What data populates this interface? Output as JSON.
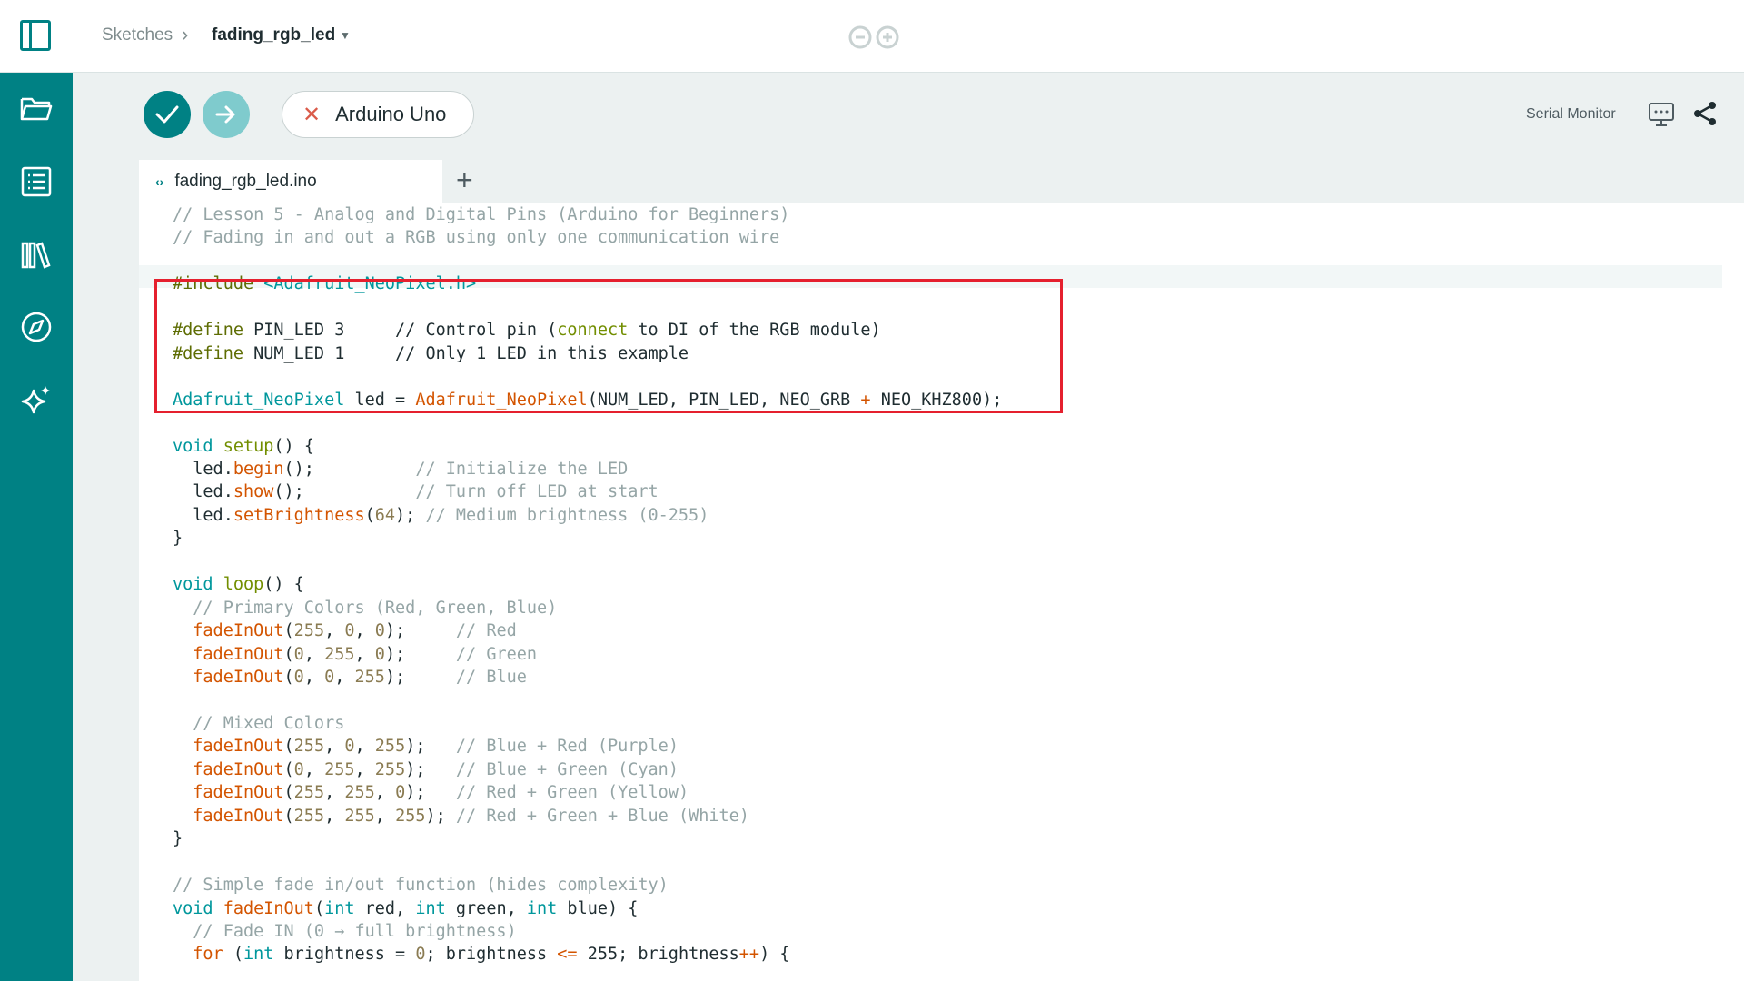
{
  "breadcrumb": {
    "root": "Sketches",
    "separator": "›",
    "current": "fading_rgb_led"
  },
  "toolbar": {
    "board_name": "Arduino Uno",
    "serial_monitor_label": "Serial Monitor",
    "verify_icon": "check-icon",
    "upload_icon": "arrow-right-icon"
  },
  "tabs": {
    "file_name": "fading_rgb_led.ino",
    "file_icon": "‹›",
    "add_label": "+"
  },
  "sidebar": {
    "items": [
      "folder-icon",
      "list-icon",
      "library-icon",
      "compass-icon",
      "sparkle-icon"
    ]
  },
  "editor": {
    "current_line": 3,
    "highlighted_lines": [
      4,
      9
    ],
    "lines": [
      "// Lesson 5 - Analog and Digital Pins (Arduino for Beginners)",
      "// Fading in and out a RGB using only one communication wire",
      "",
      "#include <Adafruit_NeoPixel.h>",
      "",
      "#define PIN_LED 3     // Control pin (connect to DI of the RGB module)",
      "#define NUM_LED 1     // Only 1 LED in this example",
      "",
      "Adafruit_NeoPixel led = Adafruit_NeoPixel(NUM_LED, PIN_LED, NEO_GRB + NEO_KHZ800);",
      "",
      "void setup() {",
      "  led.begin();          // Initialize the LED",
      "  led.show();           // Turn off LED at start",
      "  led.setBrightness(64); // Medium brightness (0-255)",
      "}",
      "",
      "void loop() {",
      "  // Primary Colors (Red, Green, Blue)",
      "  fadeInOut(255, 0, 0);     // Red",
      "  fadeInOut(0, 255, 0);     // Green",
      "  fadeInOut(0, 0, 255);     // Blue",
      "",
      "  // Mixed Colors",
      "  fadeInOut(255, 0, 255);   // Blue + Red (Purple)",
      "  fadeInOut(0, 255, 255);   // Blue + Green (Cyan)",
      "  fadeInOut(255, 255, 0);   // Red + Green (Yellow)",
      "  fadeInOut(255, 255, 255); // Red + Green + Blue (White)",
      "}",
      "",
      "// Simple fade in/out function (hides complexity)",
      "void fadeInOut(int red, int green, int blue) {",
      "  // Fade IN (0 → full brightness)",
      "  for (int brightness = 0; brightness <= 255; brightness++) {"
    ]
  },
  "colors": {
    "brand": "#008184",
    "toolbar_bg": "#ecf1f1",
    "highlight_border": "#e5202e",
    "comment": "#95a5a6",
    "keyword": "#728e00",
    "function": "#d35400",
    "type": "#00979c"
  },
  "editor_actions": [
    "undo-icon",
    "redo-icon",
    "fullscreen-icon",
    "indent-icon"
  ]
}
